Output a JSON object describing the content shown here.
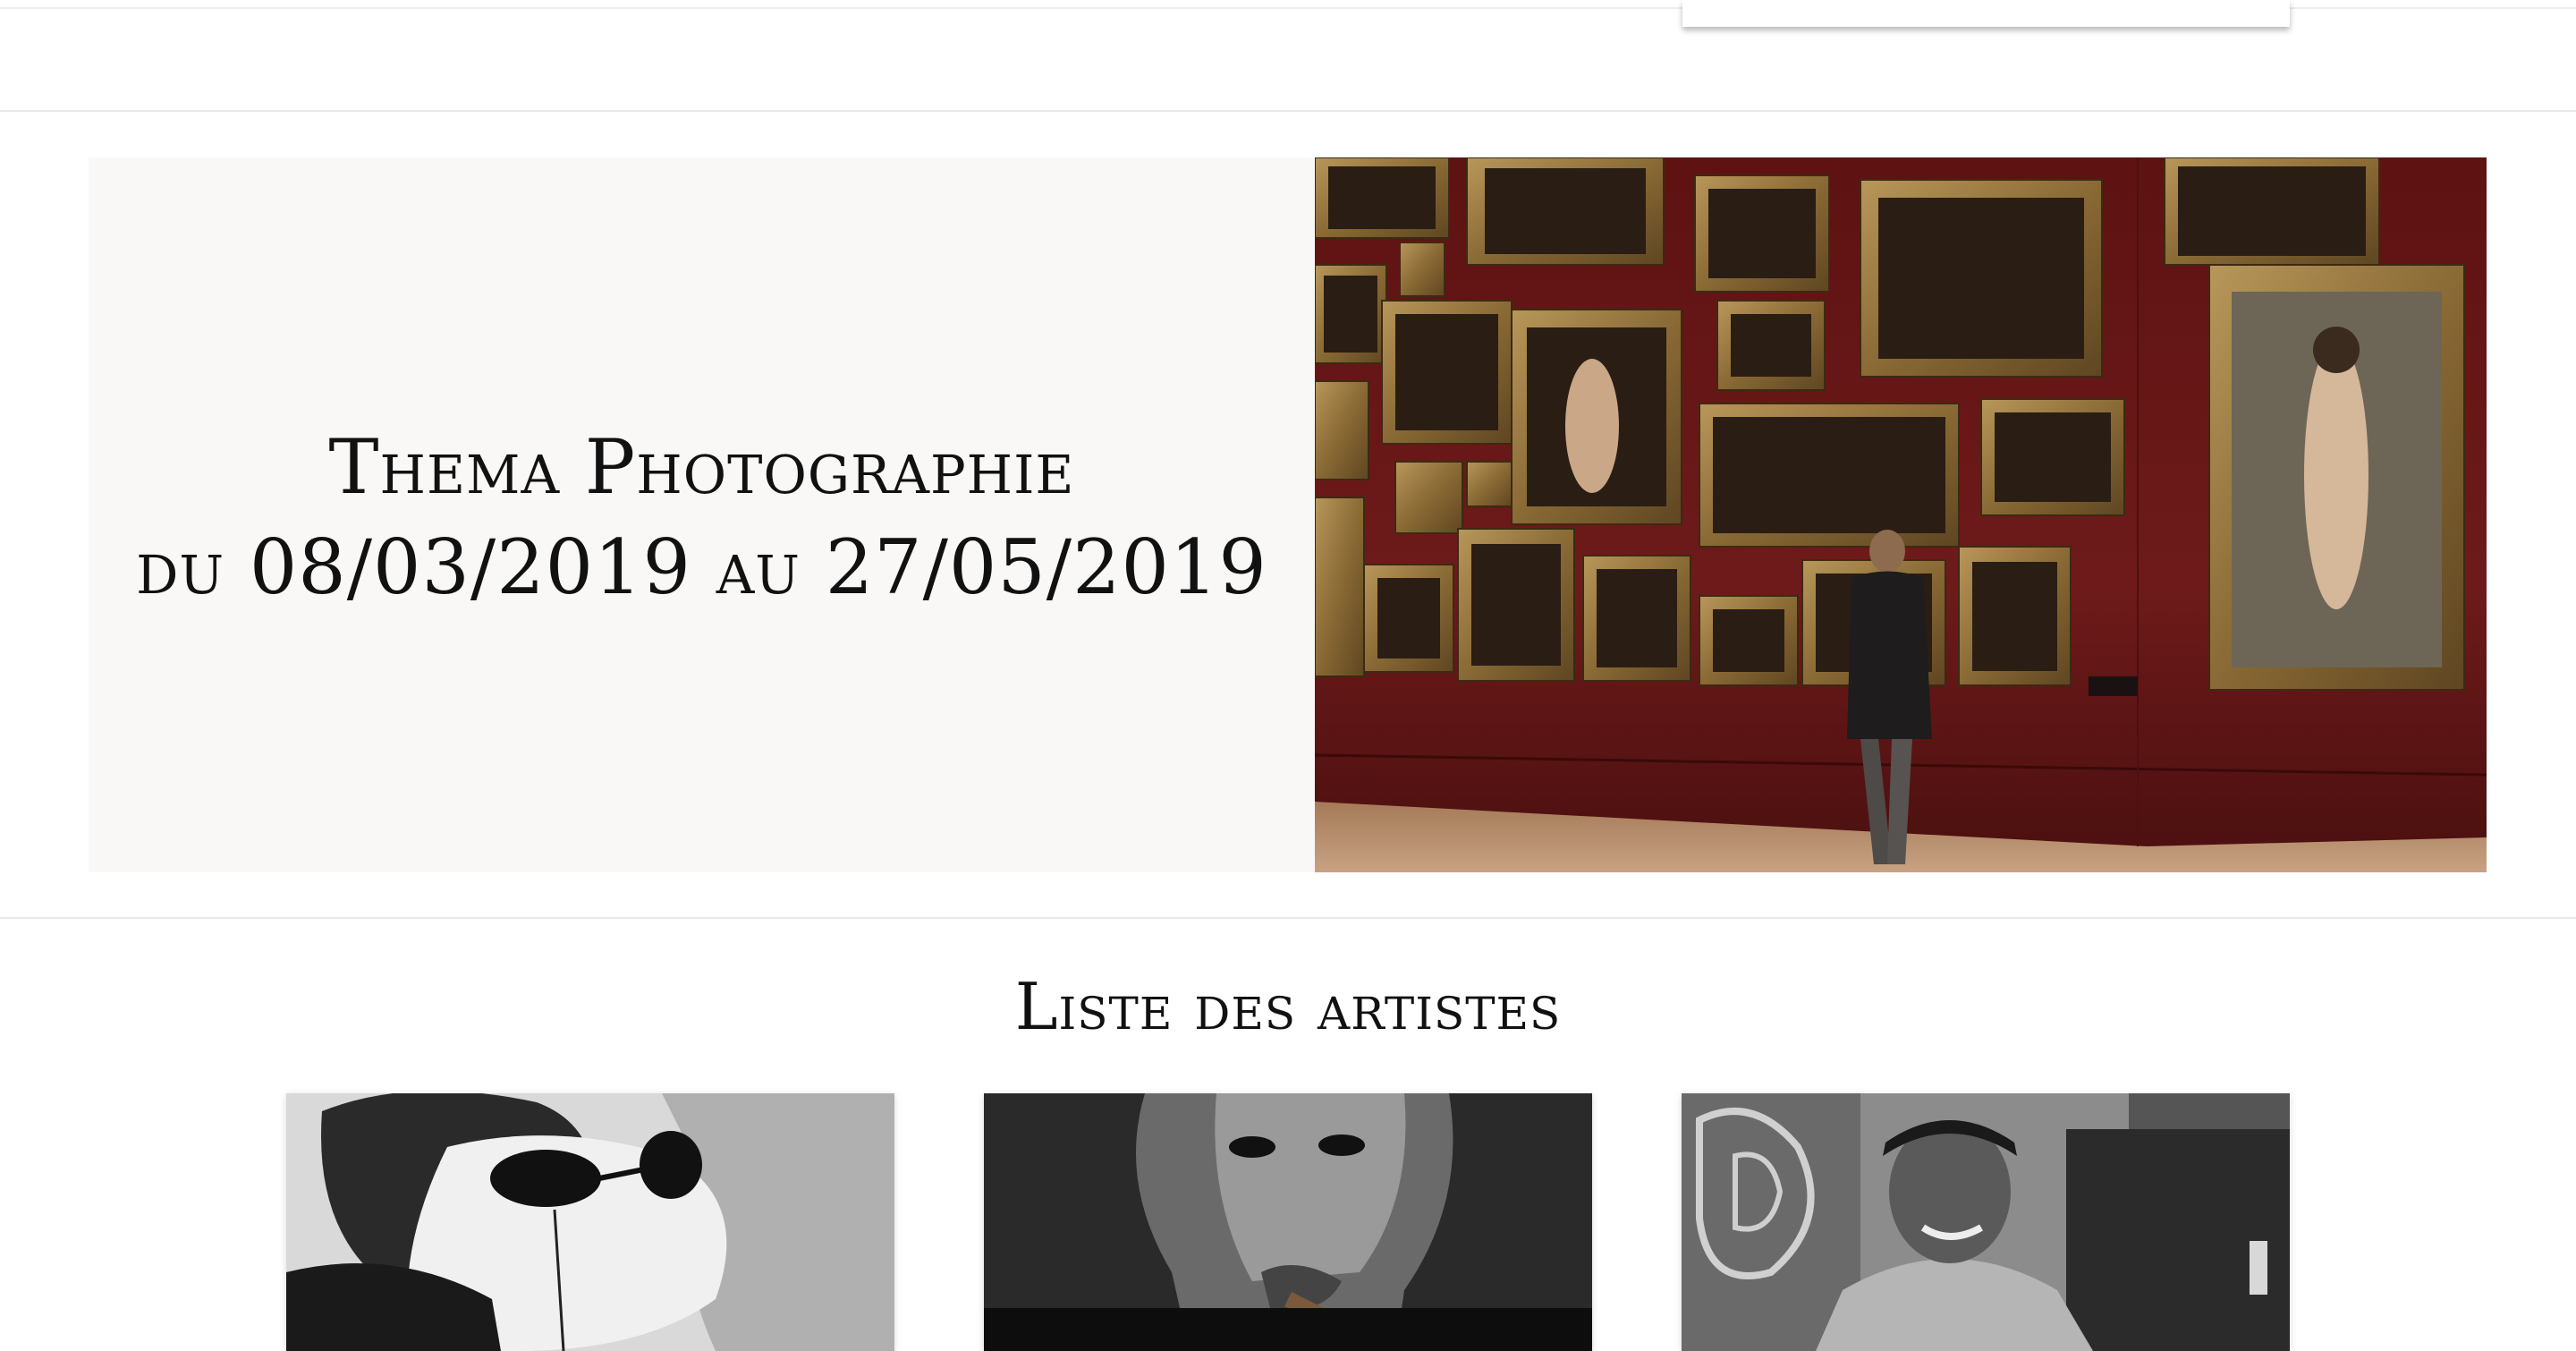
{
  "hero": {
    "title_line1": "Thema Photographie",
    "title_line2": "du 08/03/2019 au 27/05/2019",
    "image": "gallery-visitor-photo"
  },
  "artists_section": {
    "title": "Liste des artistes",
    "artists": [
      {
        "image": "portrait-woman-sunglasses"
      },
      {
        "image": "portrait-man-cigar"
      },
      {
        "image": "portrait-woman-headband"
      }
    ]
  }
}
